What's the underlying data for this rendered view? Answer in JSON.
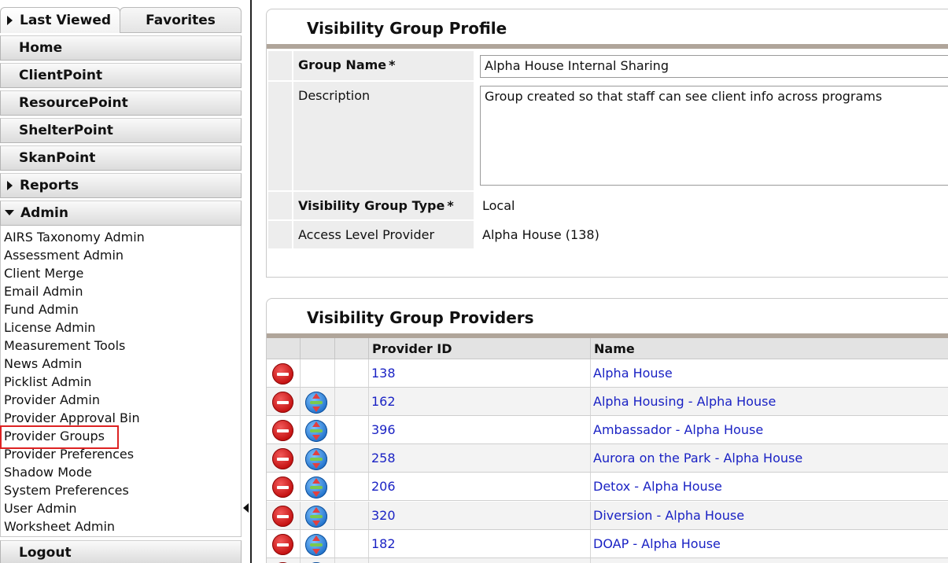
{
  "sidebar": {
    "tabs": {
      "last_viewed": "Last Viewed",
      "favorites": "Favorites"
    },
    "nav": {
      "home": "Home",
      "clientpoint": "ClientPoint",
      "resourcepoint": "ResourcePoint",
      "shelterpoint": "ShelterPoint",
      "skanpoint": "SkanPoint",
      "reports": "Reports",
      "admin": "Admin",
      "logout": "Logout"
    },
    "admin_items": [
      "AIRS Taxonomy Admin",
      "Assessment Admin",
      "Client Merge",
      "Email Admin",
      "Fund Admin",
      "License Admin",
      "Measurement Tools",
      "News Admin",
      "Picklist Admin",
      "Provider Admin",
      "Provider Approval Bin",
      "Provider Groups",
      "Provider Preferences",
      "Shadow Mode",
      "System Preferences",
      "User Admin",
      "Worksheet Admin"
    ],
    "selected_admin_item": "Provider Groups"
  },
  "profile": {
    "title": "Visibility Group Profile",
    "group_name_label": "Group Name",
    "group_name_value": "Alpha House Internal Sharing",
    "description_label": "Description",
    "description_value": "Group created so that staff can see client info across programs",
    "type_label": "Visibility Group Type",
    "type_value": "Local",
    "access_label": "Access Level Provider",
    "access_value": "Alpha House (138)",
    "required_mark": "*"
  },
  "providers": {
    "title": "Visibility Group Providers",
    "col_id": "Provider ID",
    "col_name": "Name",
    "rows": [
      {
        "id": "138",
        "name": "Alpha House",
        "has_swap": false
      },
      {
        "id": "162",
        "name": "Alpha Housing - Alpha House",
        "has_swap": true
      },
      {
        "id": "396",
        "name": "Ambassador - Alpha House",
        "has_swap": true
      },
      {
        "id": "258",
        "name": "Aurora on the Park - Alpha House",
        "has_swap": true
      },
      {
        "id": "206",
        "name": "Detox - Alpha House",
        "has_swap": true
      },
      {
        "id": "320",
        "name": "Diversion - Alpha House",
        "has_swap": true
      },
      {
        "id": "182",
        "name": "DOAP - Alpha House",
        "has_swap": true
      }
    ]
  },
  "colors": {
    "link": "#1a22c4",
    "highlight": "#dd2222",
    "title_bar": "#b0a59a",
    "label_bg": "#ededed"
  }
}
